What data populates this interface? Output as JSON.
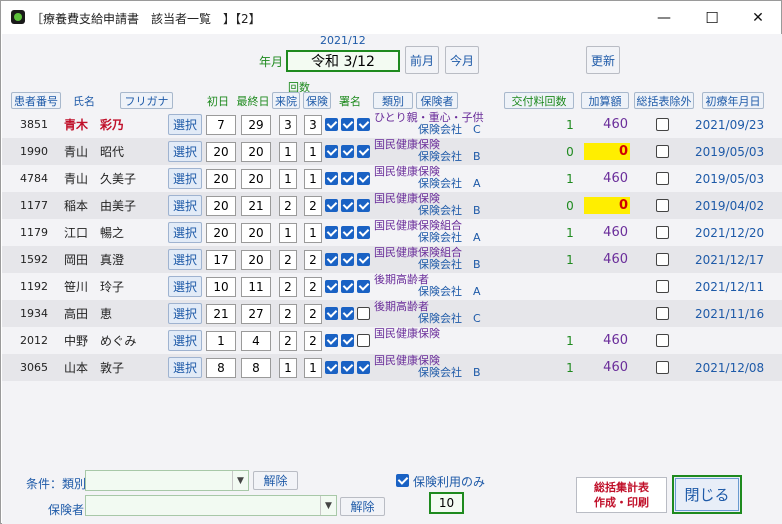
{
  "window": {
    "title": "［療養費支給申請書　該当者一覧　】【2】",
    "minimize": "—",
    "maximize": "☐",
    "close": "✕"
  },
  "period": {
    "label": "年月",
    "year_month": "2021/12",
    "value": "令和 3/12",
    "prev_button": "前月",
    "this_month_button": "今月",
    "refresh_button": "更新"
  },
  "columns": {
    "patient_no": "患者番号",
    "name": "氏名",
    "kana": "フリガナ",
    "first_day": "初日",
    "last_day": "最終日",
    "visits_top": "回数",
    "visits": "来院",
    "insurance_count": "保険",
    "signature": "署名",
    "category": "類別",
    "insurer": "保険者",
    "issue_count": "交付料回数",
    "addition": "加算額",
    "exclude": "総括表除外",
    "first_visit": "初療年月日"
  },
  "select_label": "選択",
  "rows": [
    {
      "id": "3851",
      "name": "青木　彩乃",
      "highlight": true,
      "first": "7",
      "last": "29",
      "visits": "3",
      "ins": "3",
      "c1": true,
      "c2": true,
      "c3": true,
      "category": "ひとり親・重心・子供",
      "insurer": "保険会社　C",
      "count": "1",
      "amount": "460",
      "zero": false,
      "date": "2021/09/23"
    },
    {
      "id": "1990",
      "name": "青山　昭代",
      "highlight": false,
      "first": "20",
      "last": "20",
      "visits": "1",
      "ins": "1",
      "c1": true,
      "c2": true,
      "c3": true,
      "category": "国民健康保険",
      "insurer": "保険会社　B",
      "count": "0",
      "amount": "0",
      "zero": true,
      "date": "2019/05/03"
    },
    {
      "id": "4784",
      "name": "青山　久美子",
      "highlight": false,
      "first": "20",
      "last": "20",
      "visits": "1",
      "ins": "1",
      "c1": true,
      "c2": true,
      "c3": true,
      "category": "国民健康保険",
      "insurer": "保険会社　A",
      "count": "1",
      "amount": "460",
      "zero": false,
      "date": "2019/05/03"
    },
    {
      "id": "1177",
      "name": "稲本　由美子",
      "highlight": false,
      "first": "20",
      "last": "21",
      "visits": "2",
      "ins": "2",
      "c1": true,
      "c2": true,
      "c3": true,
      "category": "国民健康保険",
      "insurer": "保険会社　B",
      "count": "0",
      "amount": "0",
      "zero": true,
      "date": "2019/04/02"
    },
    {
      "id": "1179",
      "name": "江口　暢之",
      "highlight": false,
      "first": "20",
      "last": "20",
      "visits": "1",
      "ins": "1",
      "c1": true,
      "c2": true,
      "c3": true,
      "category": "国民健康保険組合",
      "insurer": "保険会社　A",
      "count": "1",
      "amount": "460",
      "zero": false,
      "date": "2021/12/20"
    },
    {
      "id": "1592",
      "name": "岡田　真澄",
      "highlight": false,
      "first": "17",
      "last": "20",
      "visits": "2",
      "ins": "2",
      "c1": true,
      "c2": true,
      "c3": true,
      "category": "国民健康保険組合",
      "insurer": "保険会社　B",
      "count": "1",
      "amount": "460",
      "zero": false,
      "date": "2021/12/17"
    },
    {
      "id": "1192",
      "name": "笹川　玲子",
      "highlight": false,
      "first": "10",
      "last": "11",
      "visits": "2",
      "ins": "2",
      "c1": true,
      "c2": true,
      "c3": true,
      "category": "後期高齢者",
      "insurer": "保険会社　A",
      "count": "",
      "amount": "",
      "zero": false,
      "date": "2021/12/11"
    },
    {
      "id": "1934",
      "name": "高田　恵",
      "highlight": false,
      "first": "21",
      "last": "27",
      "visits": "2",
      "ins": "2",
      "c1": true,
      "c2": true,
      "c3": false,
      "category": "後期高齢者",
      "insurer": "保険会社　C",
      "count": "",
      "amount": "",
      "zero": false,
      "date": "2021/11/16"
    },
    {
      "id": "2012",
      "name": "中野　めぐみ",
      "highlight": false,
      "first": "1",
      "last": "4",
      "visits": "2",
      "ins": "2",
      "c1": true,
      "c2": true,
      "c3": false,
      "category": "国民健康保険",
      "insurer": "",
      "count": "1",
      "amount": "460",
      "zero": false,
      "date": ""
    },
    {
      "id": "3065",
      "name": "山本　敦子",
      "highlight": false,
      "first": "8",
      "last": "8",
      "visits": "1",
      "ins": "1",
      "c1": true,
      "c2": true,
      "c3": true,
      "category": "国民健康保険",
      "insurer": "保険会社　B",
      "count": "1",
      "amount": "460",
      "zero": false,
      "date": "2021/12/08"
    }
  ],
  "filters": {
    "category_label": "条件：類別",
    "category_value": "",
    "insurer_label": "保険者",
    "insurer_value": "",
    "clear_button": "解除",
    "insurance_only_label": "保険利用のみ",
    "insurance_only_checked": true,
    "total_count": "10"
  },
  "footer": {
    "summary_button_line1": "総括集計表",
    "summary_button_line2": "作成・印刷",
    "close_button": "閉じる"
  }
}
